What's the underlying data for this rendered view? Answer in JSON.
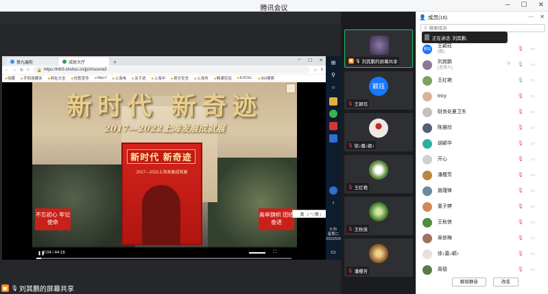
{
  "window": {
    "title": "腾讯会议"
  },
  "browser": {
    "tabs": [
      {
        "label": "第九编剪"
      },
      {
        "label": "成就大厅"
      }
    ],
    "url": "https://hth5.shshsc.cn/jjz/#/scene3",
    "bookmarks": [
      "收藏",
      "手机收藏夹",
      "网址大全",
      "创意宣传",
      "http://",
      "上海电",
      "关于进",
      "上海中",
      "昆仑安全",
      "上海市",
      "畅课实验",
      "EXCEL",
      "360搜索"
    ]
  },
  "video": {
    "headline": "新时代 新奇迹",
    "subline": "2017—2022上海发展成就展",
    "banner_title": "新时代 新奇迹",
    "banner_sub": "2017—2022上海发展成就展",
    "board_left": "不忘初心 牢记使命",
    "board_right": "高举旗帜 团结奋进",
    "time": "0:04 / 44:16",
    "progress_fraction": 0.02
  },
  "ime": "英 ☽ ° ⁄ 简 ⁝",
  "taskbar": {
    "time": "9:35",
    "day": "星期二",
    "date": "2022/5/9"
  },
  "sharer": {
    "label": "刘其鹏的屏幕共享"
  },
  "tiles": [
    {
      "name": "刘其鹏的屏幕共享",
      "avatar": "#5a4a6a",
      "active": true,
      "muted": false,
      "sharing": true
    },
    {
      "name": "王颖珏",
      "avatar": "#1677ff",
      "initials": "颖珏",
      "muted": true
    },
    {
      "name": "徐♪嘉♪颖♪",
      "avatar": "#e5e0dc",
      "muted": true
    },
    {
      "name": "王红艳",
      "avatar": "#7aa25a",
      "muted": true
    },
    {
      "name": "王秋侠",
      "avatar": "#4f8f3d",
      "muted": true
    },
    {
      "name": "潘樱芳",
      "avatar": "#b8873c",
      "muted": true
    }
  ],
  "panel": {
    "title": "成员(16)",
    "search_placeholder": "搜索成员",
    "speaking_text": "正在讲话: 刘其鹏;",
    "members": [
      {
        "name": "王颖珏",
        "role": "(我)",
        "avatar": "#1677ff",
        "initials": "颖珏",
        "mic": "off",
        "cam": "off"
      },
      {
        "name": "刘其鹏",
        "role": "(主持人)",
        "avatar": "#8a7a9a",
        "mic": "on",
        "cam": "off",
        "shield": true
      },
      {
        "name": "王红艳",
        "role": "",
        "avatar": "#7aa25a",
        "mic": "on",
        "cam": "off"
      },
      {
        "name": "tricy",
        "role": "",
        "avatar": "#d9b49a",
        "mic": "off",
        "cam": "off"
      },
      {
        "name": "财务处夏卫东",
        "role": "",
        "avatar": "#c0c0c0",
        "mic": "off",
        "cam": "off"
      },
      {
        "name": "陈雅欣",
        "role": "",
        "avatar": "#556070",
        "mic": "off",
        "cam": "off"
      },
      {
        "name": "胡颖华",
        "role": "",
        "avatar": "#2bb0a0",
        "mic": "off",
        "cam": "off"
      },
      {
        "name": "开心",
        "role": "",
        "avatar": "#d0d0d0",
        "mic": "off",
        "cam": "off"
      },
      {
        "name": "潘樱芳",
        "role": "",
        "avatar": "#b8873c",
        "mic": "off",
        "cam": "off"
      },
      {
        "name": "施瑾锋",
        "role": "",
        "avatar": "#6a8aa0",
        "mic": "off",
        "cam": "off"
      },
      {
        "name": "童子婷",
        "role": "",
        "avatar": "#d08a5a",
        "mic": "off",
        "cam": "off"
      },
      {
        "name": "王秋侠",
        "role": "",
        "avatar": "#4f8f3d",
        "mic": "off",
        "cam": "off"
      },
      {
        "name": "吴依梅",
        "role": "",
        "avatar": "#a07060",
        "mic": "off",
        "cam": "off"
      },
      {
        "name": "徐♪嘉♪颖♪",
        "role": "",
        "avatar": "#e5e0dc",
        "mic": "off",
        "cam": "off"
      },
      {
        "name": "周德",
        "role": "",
        "avatar": "#5a7a4a",
        "mic": "off",
        "cam": "off"
      }
    ],
    "mute_all_label": "解除静音",
    "rename_label": "改名"
  }
}
